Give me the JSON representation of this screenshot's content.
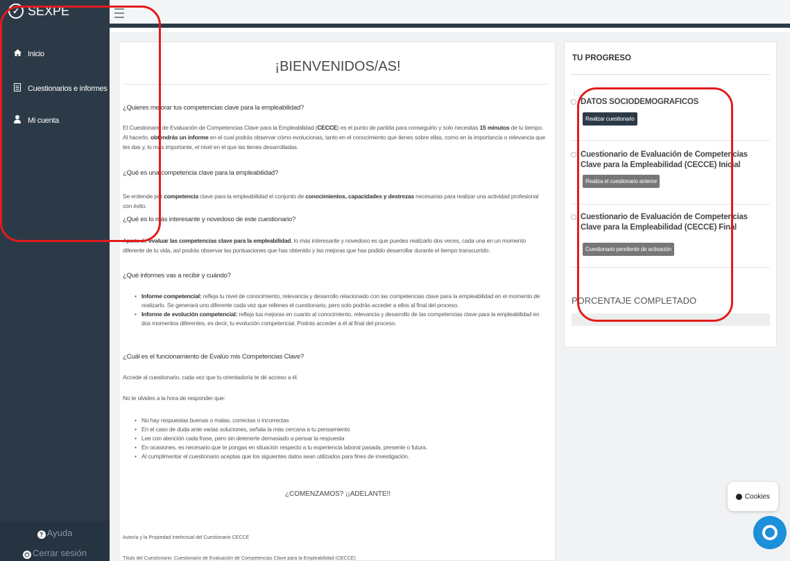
{
  "brand": {
    "name": "SEXPE",
    "icon": "checkbox-icon"
  },
  "sidebar": {
    "items": [
      {
        "label": "Inicio",
        "icon": "home-icon"
      },
      {
        "label": "Cuestionarios e informes",
        "icon": "document-icon"
      },
      {
        "label": "Mi cuenta",
        "icon": "user-icon"
      }
    ],
    "help_label": "Ayuda",
    "logout_label": "Cerrar sesión"
  },
  "main": {
    "title": "¡BIENVENIDOS/AS!",
    "q1": "¿Quieres mejorar tus competencias clave para la empleabilidad?",
    "p1": {
      "a": "El Cuestionario de Evaluación de Competencias Clave para la Empleabilidad (",
      "b": "CECCE",
      "c": ") es el punto de partida para conseguirlo y solo necesitas ",
      "d": "15 minutos",
      "e": " de tu tiempo. Al hacerlo, ",
      "f": "obtendrás un informe",
      "g": " en el cual podrás observar cómo evolucionas, tanto en el conocimiento que tienes sobre ellas, como en la importancia o relevancia que les das y, lo más importante, el nivel en el que las tienes desarrolladas."
    },
    "q2": "¿Qué es una competencia clave para la empleabilidad?",
    "p2": {
      "a": "Se entiende por ",
      "b": "competencia",
      "c": " clave para la empleabilidad el conjunto de ",
      "d": "conocimientos, capacidades y destrezas",
      "e": " necesarias para realizar una actividad profesional con éxito."
    },
    "q3": "¿Qué es lo más interesante y novedoso de este cuestionario?",
    "p3": {
      "a": "Aparte de ",
      "b": "evaluar las competencias clave para la empleabilidad",
      "c": ", lo más interesante y novedoso es que puedes realizarlo dos veces, cada una en un momento diferente de tu vida, así podrás observar las puntuaciones que has obtenido y las mejoras que has podido desarrollar durante el tiempo transcurrido."
    },
    "q4": "¿Qué informes vas a recibir y cuándo?",
    "reports": [
      {
        "bold": "Informe competencial:",
        "text": " refleja tu nivel de conocimiento, relevancia y desarrollo relacionado con las competencias clave para la empleabilidad en el momento de realizarlo. Se generará uno diferente cada vez que rellenes el cuestionario, pero solo podrás acceder a ellos al final del proceso."
      },
      {
        "bold": "Informe de evolución competencial:",
        "text": " refleja tus mejoras en cuanto al conocimiento, relevancia y desarrollo de las competencias clave para la empleabilidad en dos momentos diferentes, es decir, tu evolución competencial. Podrás acceder a él al final del proceso."
      }
    ],
    "q5": "¿Cuál es el funcionamiento de Evalúo mis Competencias Clave?",
    "p5": "Accede al cuestionario, cada vez que tu orientadoría te dé acceso a él.",
    "p6": "No te olvides a la hora de responder que:",
    "tips": [
      "No hay respuestas buenas o malas, correctas o incorrectas",
      "En el caso de duda ante varias soluciones, señala la más cercana a tu pensamiento",
      "Lee con atención cada frase, pero sin detenerte demasiado a pensar la respuesta",
      "En ocasiones, es necesario que te pongas en situación respecto a tu experiencia laboral pasada, presente o futura.",
      "Al cumplimentar el cuestionario aceptas que los siguientes datos sean utilizados para fines de investigación."
    ],
    "cta": "¿COMENZAMOS? ¡¡ADELANTE!!",
    "footer1": "Autoría y la Propiedad Intelectual del Cuestionario CECCE",
    "footer2": "Título del Cuestionario: Cuestionario de Evaluación de Competencias Clave para la Empleabilidad (CECCE)"
  },
  "progress": {
    "title": "TU PROGRESO",
    "steps": [
      {
        "title": "DATOS SOCIODEMOGRAFICOS",
        "button": "Realizar cuestionario"
      },
      {
        "title": "Cuestionario de Evaluación de Competencias Clave para la Empleabilidad (CECCE) Inicial",
        "button": "Realiza el cuestionario anterior"
      },
      {
        "title": "Cuestionario de Evaluación de Competencias Clave para la Empleabilidad (CECCE) Final",
        "button": "Cuestionario pendiente de activación"
      }
    ],
    "percent_label": "PORCENTAJE COMPLETADO",
    "percent_value": 0
  },
  "cookies_label": "Cookies",
  "colors": {
    "sidebar": "#2c3a47",
    "annotation": "#e31b1b",
    "chat": "#1e8fd9"
  }
}
